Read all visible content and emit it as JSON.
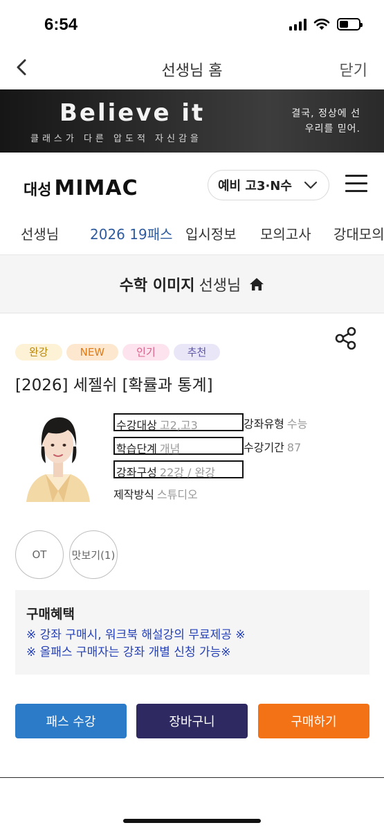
{
  "status_bar": {
    "time": "6:54"
  },
  "nav": {
    "title": "선생님 홈",
    "close_label": "닫기"
  },
  "banner": {
    "title": "Believe it",
    "subtitle": "클래스가 다른 압도적 자신감을",
    "right_line1": "결국, 정상에 선",
    "right_line2": "우리를 믿어."
  },
  "logo": {
    "korean": "대성",
    "english": "MIMAC"
  },
  "grade_select": {
    "value": "예비 고3·N수"
  },
  "tabs": [
    {
      "label": "선생님"
    },
    {
      "label": "2026 19패스"
    },
    {
      "label": "입시정보"
    },
    {
      "label": "모의고사"
    },
    {
      "label": "강대모의"
    }
  ],
  "teacher": {
    "name": "수학 이미지",
    "suffix": "선생님"
  },
  "course": {
    "badges": [
      {
        "label": "완강",
        "bg": "#fdf1d6",
        "color": "#b8860b"
      },
      {
        "label": "NEW",
        "bg": "#fde8cf",
        "color": "#e07b1a"
      },
      {
        "label": "인기",
        "bg": "#fde3ee",
        "color": "#d9608a"
      },
      {
        "label": "추천",
        "bg": "#e9e6f8",
        "color": "#5c55a8"
      }
    ],
    "title": "[2026] 세젤쉬 [확률과 통계]",
    "info": {
      "target_label": "수강대상",
      "target_value": "고2,고3",
      "type_label": "강좌유형",
      "type_value": "수능",
      "level_label": "학습단계",
      "level_value": "개념",
      "period_label": "수강기간",
      "period_value": "87",
      "composition_label": "강좌구성",
      "composition_value": "22강 / 완강",
      "production_label": "제작방식",
      "production_value": "스튜디오"
    },
    "ot_label": "OT",
    "preview_label": "맛보기(1)"
  },
  "benefits": {
    "title": "구매혜택",
    "line1": "※ 강좌 구매시, 워크북 해설강의 무료제공 ※",
    "line2": "※ 올패스 구매자는 강좌 개별 신청 가능※"
  },
  "actions": {
    "pass_label": "패스 수강",
    "cart_label": "장바구니",
    "buy_label": "구매하기"
  },
  "colors": {
    "pass": "#2b7bc9",
    "cart": "#2e2a61",
    "buy": "#f47216",
    "active_tab": "#2f5b9f",
    "benefit_text": "#2440b8"
  }
}
